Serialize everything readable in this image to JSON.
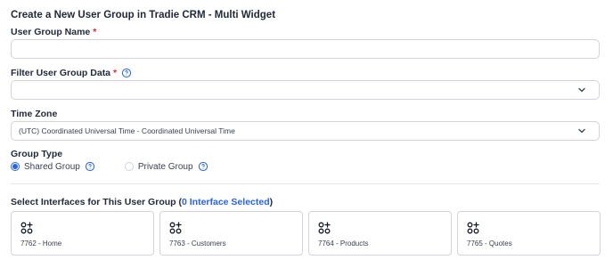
{
  "title": "Create a New User Group in Tradie CRM - Multi Widget",
  "user_group_name": {
    "label": "User Group Name",
    "required_mark": "*",
    "value": ""
  },
  "filter_data": {
    "label": "Filter User Group Data",
    "required_mark": "*",
    "value": ""
  },
  "time_zone": {
    "label": "Time Zone",
    "value": "(UTC) Coordinated Universal Time - Coordinated Universal Time"
  },
  "group_type": {
    "label": "Group Type",
    "options": [
      {
        "label": "Shared Group",
        "selected": true
      },
      {
        "label": "Private Group",
        "selected": false
      }
    ]
  },
  "interfaces": {
    "heading": "Select Interfaces for This User Group",
    "open_paren": "(",
    "selected_text": "0 Interface Selected",
    "close_paren": ")",
    "items": [
      {
        "label": "7762 - Home"
      },
      {
        "label": "7763 - Customers"
      },
      {
        "label": "7764 - Products"
      },
      {
        "label": "7765 - Quotes"
      }
    ]
  },
  "colors": {
    "accent": "#2563eb",
    "required": "#dc2626",
    "border": "#d1d5db"
  }
}
